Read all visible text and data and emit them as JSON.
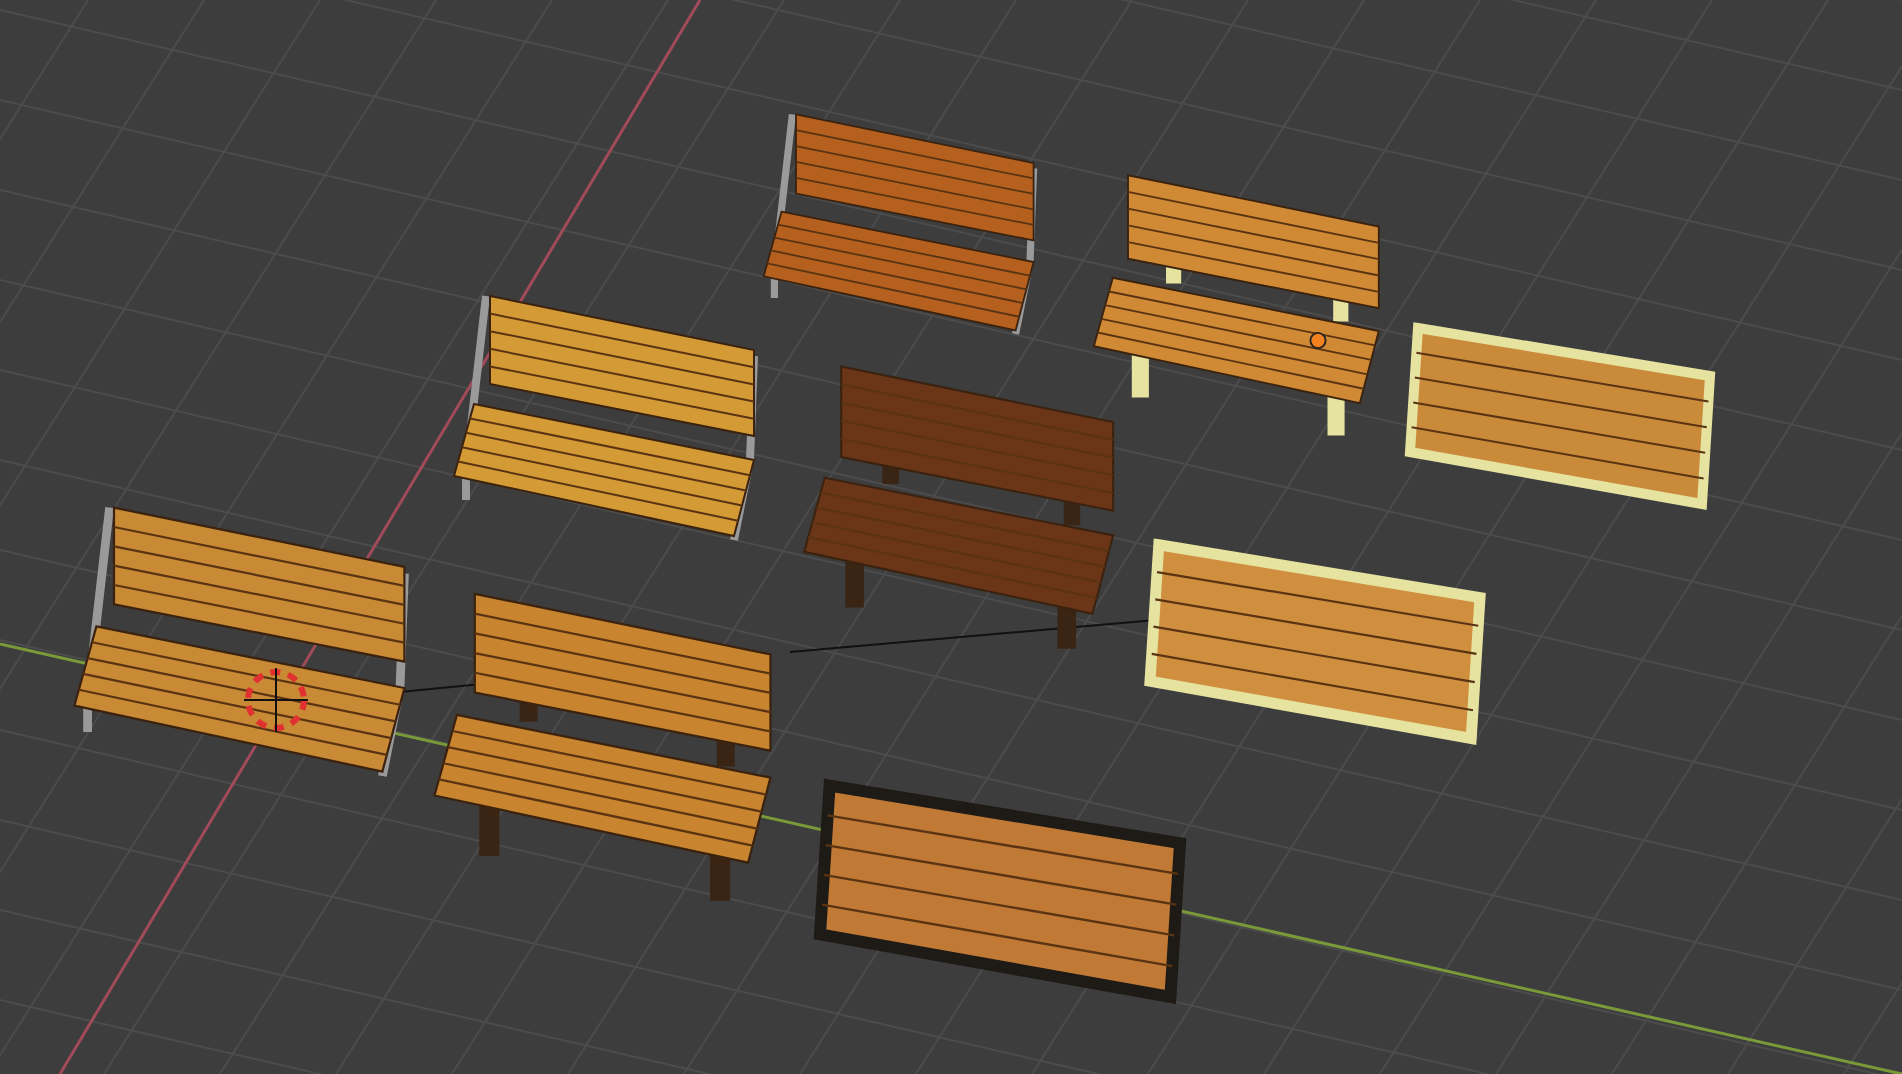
{
  "viewport": {
    "benches": [
      {
        "kind": "metal",
        "selected": false
      },
      {
        "kind": "pale-legs",
        "selected": true
      },
      {
        "kind": "metal",
        "selected": false
      },
      {
        "kind": "dark-legs",
        "selected": false
      },
      {
        "kind": "box",
        "selected": false
      },
      {
        "kind": "metal",
        "selected": false
      },
      {
        "kind": "dark-legs",
        "selected": false
      },
      {
        "kind": "box",
        "selected": false
      },
      {
        "kind": "dark-box",
        "selected": false
      }
    ]
  }
}
